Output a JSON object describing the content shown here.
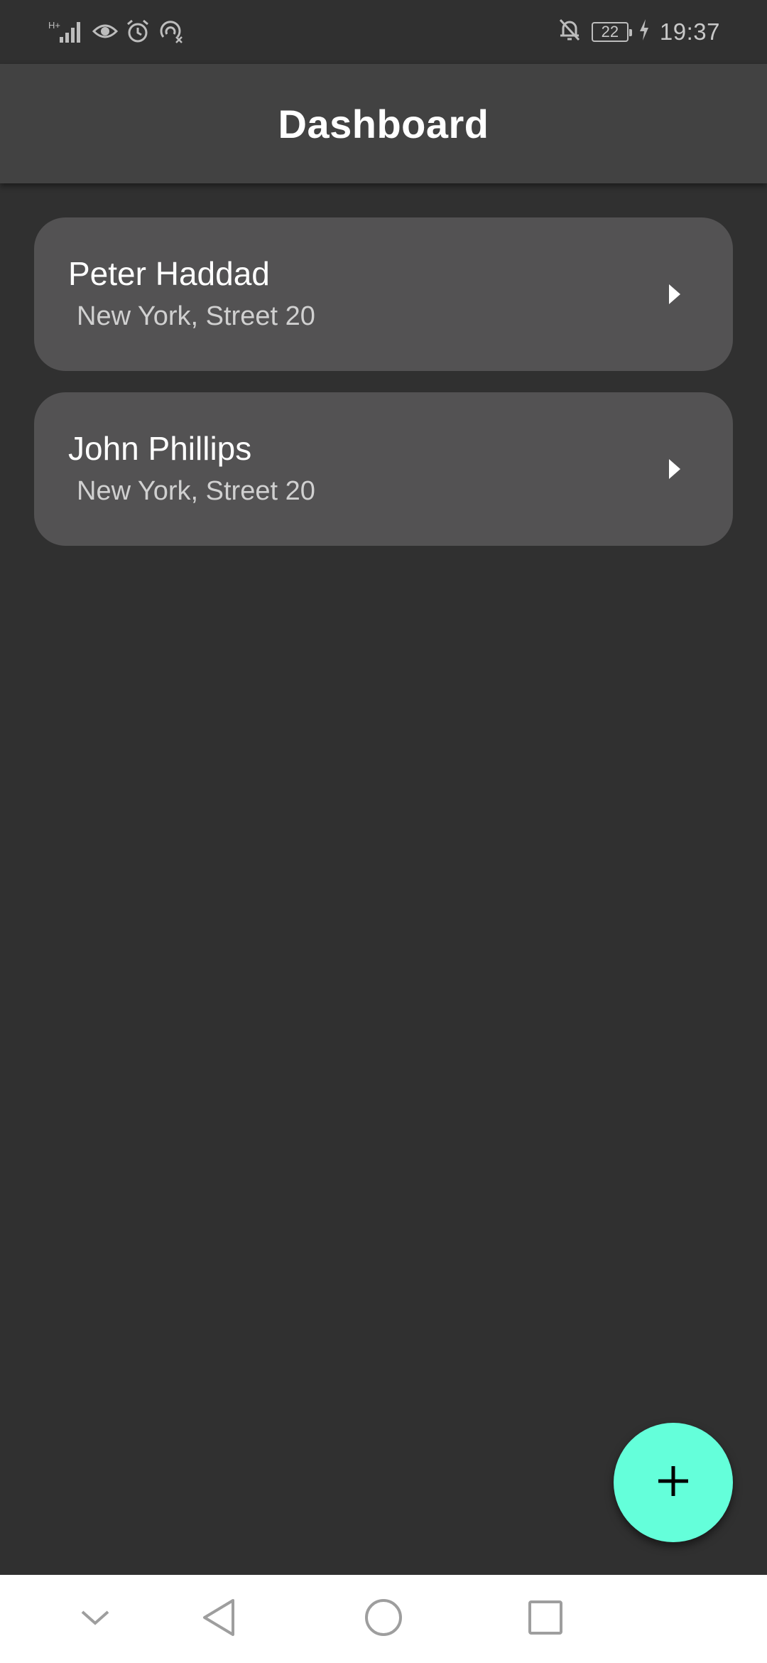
{
  "status_bar": {
    "time": "19:37",
    "battery_level": "22",
    "left_icons": [
      "signal-icon",
      "eye-icon",
      "alarm-icon",
      "hotspot-off-icon"
    ],
    "right_icons": [
      "bell-off-icon",
      "battery-icon",
      "charging-icon"
    ]
  },
  "app_bar": {
    "title": "Dashboard"
  },
  "contacts": [
    {
      "name": "Peter Haddad",
      "address": "New York, Street 20"
    },
    {
      "name": "John Phillips",
      "address": "New York, Street 20"
    }
  ],
  "fab": {
    "icon": "plus-icon"
  },
  "nav_bar": {
    "buttons": [
      "collapse-down-icon",
      "back-icon",
      "home-icon",
      "recents-icon"
    ]
  },
  "colors": {
    "background": "#303030",
    "app_bar": "#424242",
    "card": "#535253",
    "accent": "#64ffda",
    "nav_bar": "#ffffff"
  }
}
